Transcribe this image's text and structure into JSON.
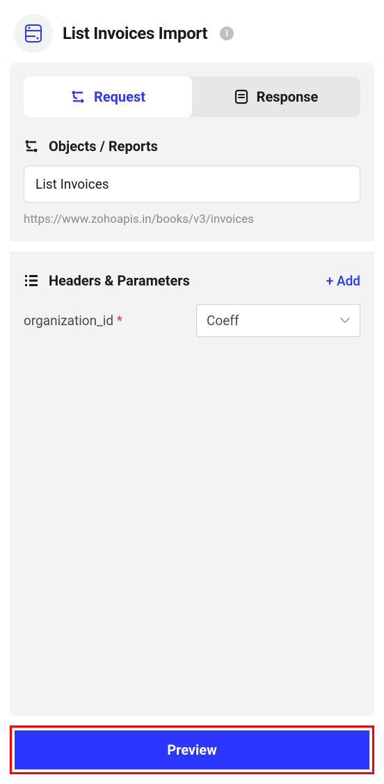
{
  "header": {
    "title": "List Invoices Import"
  },
  "tabs": {
    "request": "Request",
    "response": "Response"
  },
  "objects": {
    "title": "Objects / Reports",
    "value": "List Invoices",
    "url": "https://www.zohoapis.in/books/v3/invoices"
  },
  "headers_params": {
    "title": "Headers & Parameters",
    "add_label": "+ Add",
    "param1": {
      "label": "organization_id",
      "value": "Coeff"
    }
  },
  "footer": {
    "preview": "Preview"
  }
}
